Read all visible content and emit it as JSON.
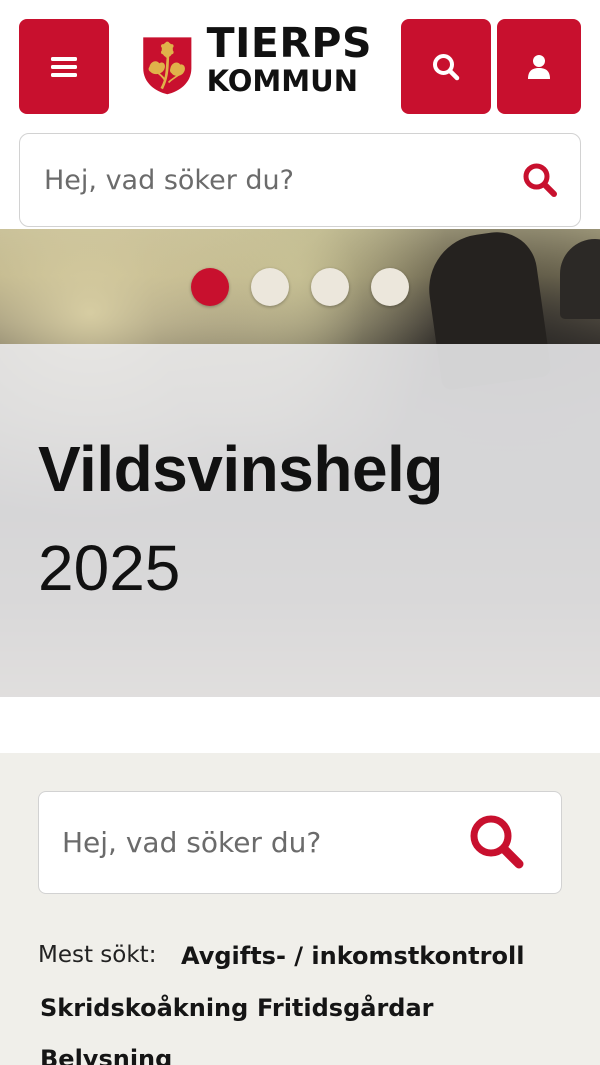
{
  "header": {
    "logo_line1": "TIERPS",
    "logo_line2": "KOMMUN",
    "brand_color": "#c8102e"
  },
  "icons": {
    "menu": "hamburger-icon",
    "search": "search-icon",
    "user": "user-icon"
  },
  "top_search": {
    "placeholder": "Hej, vad söker du?"
  },
  "hero": {
    "title": "Vildsvinshelg",
    "subtitle": "2025",
    "slides": [
      {
        "active": true
      },
      {
        "active": false
      },
      {
        "active": false
      },
      {
        "active": false
      }
    ]
  },
  "lower_search": {
    "placeholder": "Hej, vad söker du?"
  },
  "popular": {
    "label": "Mest sökt:",
    "links": [
      "Avgifts- / inkomstkontroll",
      "Skridskoåkning",
      "Fritidsgårdar",
      "Belysning"
    ]
  }
}
